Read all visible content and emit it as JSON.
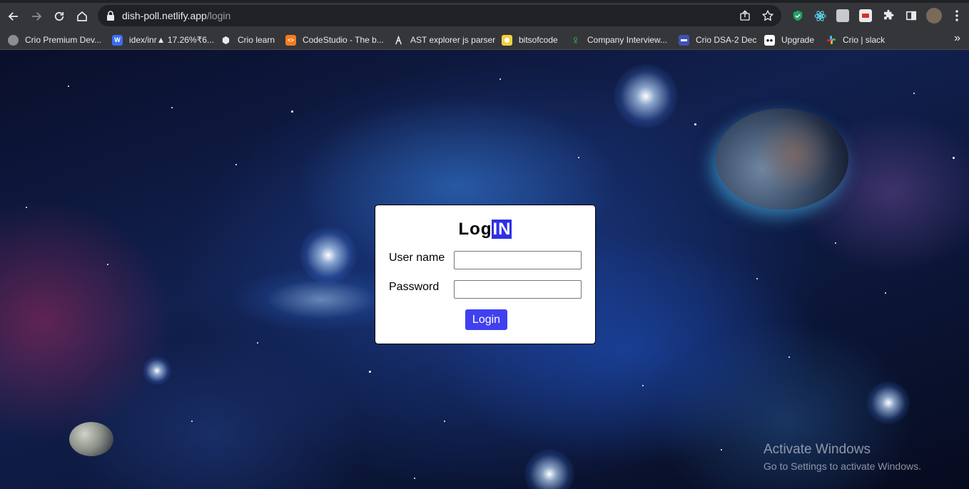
{
  "browser": {
    "url_domain": "dish-poll.netlify.app",
    "url_path": "/login",
    "toolbar_icons": [
      "back-icon",
      "forward-icon",
      "reload-icon",
      "home-icon",
      "share-icon",
      "bookmark-star-icon",
      "extensions-icon",
      "side-panel-icon",
      "profile-avatar",
      "menu-icon"
    ],
    "bookmarks": [
      {
        "label": "Crio Premium Dev...",
        "icon": "globe-icon",
        "color": "#8a8d92"
      },
      {
        "label": "idex/inr▲ 17.26%₹6...",
        "icon": "idex-icon",
        "color": "#3c6df0"
      },
      {
        "label": "Crio learn",
        "icon": "crio-icon",
        "color": "#e8eaed"
      },
      {
        "label": "CodeStudio - The b...",
        "icon": "codestudio-icon",
        "color": "#f57c1f"
      },
      {
        "label": "AST explorer js parser",
        "icon": "ast-icon",
        "color": "#e8eaed"
      },
      {
        "label": "bitsofcode",
        "icon": "bitsofcode-icon",
        "color": "#f4d03f"
      },
      {
        "label": "Company Interview...",
        "icon": "gfg-icon",
        "color": "#2f8d46"
      },
      {
        "label": "Crio DSA-2 Dec",
        "icon": "calendar-icon",
        "color": "#3f51b5"
      },
      {
        "label": "Upgrade",
        "icon": "medium-icon",
        "color": "#000000"
      },
      {
        "label": "Crio | slack",
        "icon": "slack-icon",
        "color": "#e01e5a"
      }
    ]
  },
  "login": {
    "title_plain": "Log",
    "title_highlight": "IN",
    "username_label": "User name",
    "username_value": "",
    "password_label": "Password",
    "password_value": "",
    "button_label": "Login",
    "highlight_color": "#2f2fe8",
    "button_color": "#4040f0"
  },
  "watermark": {
    "title": "Activate Windows",
    "subtitle": "Go to Settings to activate Windows."
  }
}
